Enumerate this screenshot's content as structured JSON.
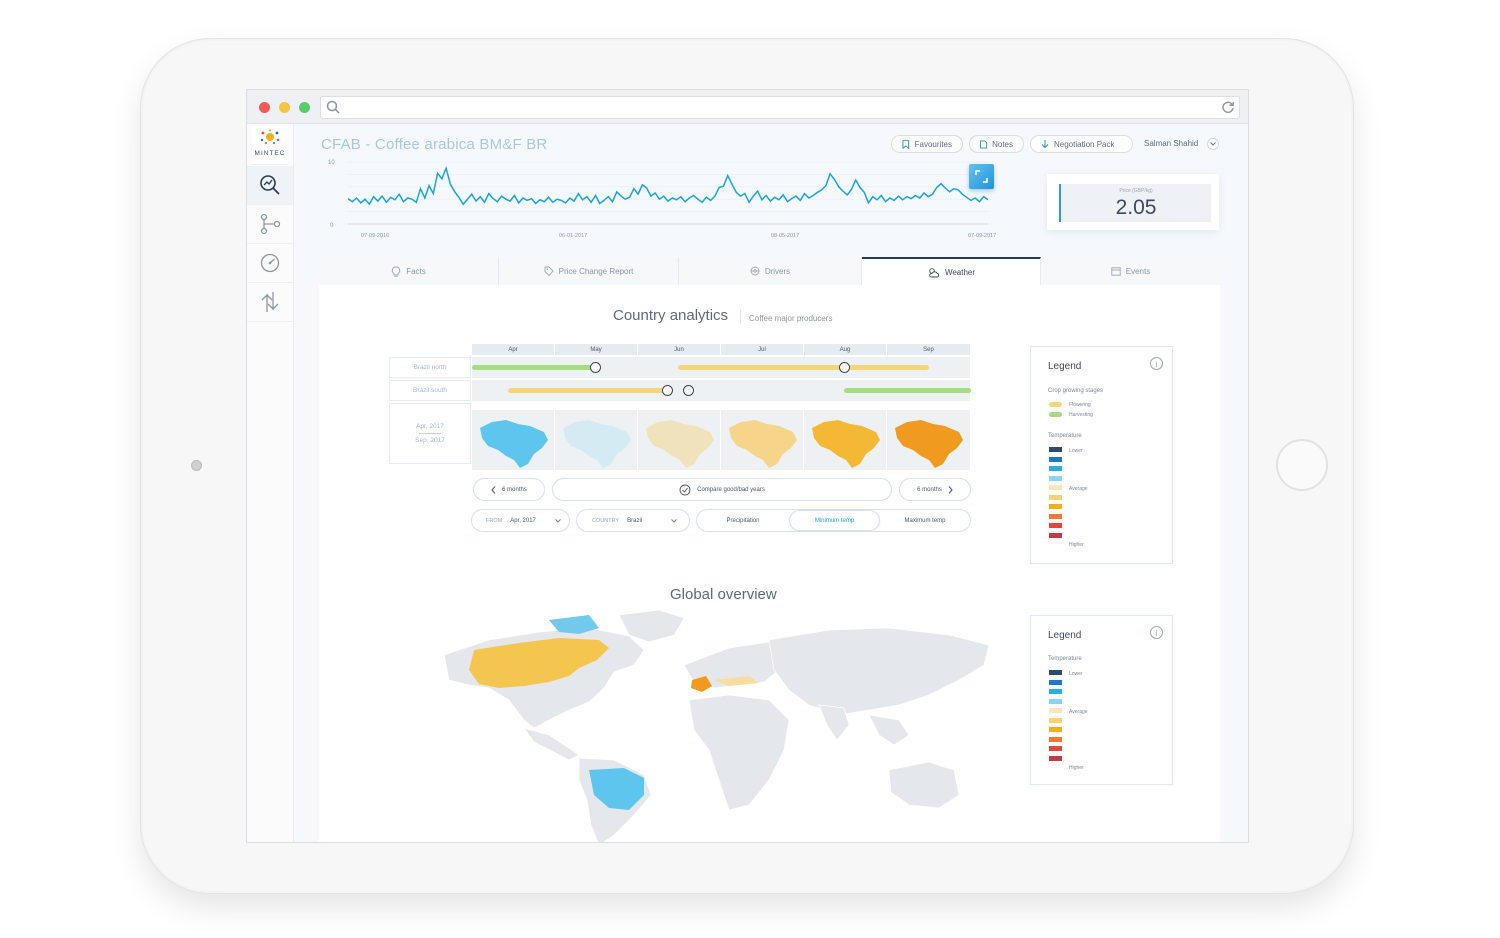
{
  "app": {
    "logo_text": "MINTEC",
    "title": "CFAB - Coffee arabica BM&F BR",
    "user_name": "Salman Shahid"
  },
  "header": {
    "favourites_label": "Favourites",
    "notes_label": "Notes",
    "negotiation_label": "Negotiation Pack"
  },
  "price": {
    "label": "Price (GBP/kg)",
    "value": "2.05"
  },
  "chart_data": {
    "type": "line",
    "ylim": [
      0,
      10
    ],
    "ytick_labels": [
      "10",
      "0"
    ],
    "x_tick_labels": [
      "07-09-2016",
      "06-01-2017",
      "08-05-2017",
      "07-09-2017"
    ],
    "color": "#1aa3dc",
    "values": [
      4.1,
      3.6,
      4.2,
      3.4,
      4.0,
      3.2,
      4.4,
      3.7,
      4.5,
      3.5,
      4.3,
      3.9,
      4.8,
      3.6,
      4.2,
      4.0,
      3.5,
      5.7,
      4.2,
      6.2,
      4.9,
      8.2,
      7.3,
      9.0,
      6.4,
      5.2,
      4.3,
      3.2,
      4.0,
      4.8,
      3.7,
      4.4,
      3.5,
      4.9,
      4.1,
      3.6,
      4.5,
      4.0,
      3.7,
      4.6,
      3.4,
      4.2,
      3.8,
      4.1,
      3.3,
      3.9,
      3.6,
      4.3,
      3.5,
      4.0,
      3.8,
      3.4,
      4.2,
      3.7,
      4.9,
      3.9,
      4.4,
      3.5,
      4.6,
      3.3,
      3.8,
      4.4,
      3.6,
      5.2,
      4.5,
      4.0,
      4.3,
      5.7,
      4.8,
      6.3,
      5.8,
      4.5,
      5.0,
      4.0,
      4.5,
      3.7,
      4.2,
      3.9,
      4.4,
      3.6,
      4.2,
      4.6,
      4.0,
      3.5,
      4.3,
      3.8,
      4.5,
      5.9,
      6.1,
      7.8,
      6.4,
      5.1,
      4.5,
      4.9,
      3.5,
      4.5,
      5.3,
      3.9,
      4.6,
      3.7,
      4.3,
      3.9,
      4.7,
      3.6,
      4.1,
      4.5,
      3.8,
      4.9,
      4.2,
      4.6,
      5.1,
      5.5,
      6.2,
      8.1,
      7.2,
      6.0,
      5.3,
      4.7,
      5.6,
      7.1,
      5.9,
      5.1,
      3.4,
      4.4,
      3.9,
      4.6,
      3.6,
      4.2,
      3.8,
      4.5,
      3.9,
      4.4,
      4.1,
      4.6,
      4.2,
      5.0,
      4.4,
      4.8,
      5.9,
      6.5,
      5.8,
      5.2,
      5.7,
      5.5,
      4.8,
      4.3,
      3.8,
      4.2,
      3.6,
      4.4,
      3.9
    ],
    "axis_color": "#aebdcc"
  },
  "tabs": [
    {
      "label": "Facts"
    },
    {
      "label": "Price Change Report"
    },
    {
      "label": "Drivers"
    },
    {
      "label": "Weather"
    },
    {
      "label": "Events"
    }
  ],
  "country": {
    "title": "Country analytics",
    "subtitle": "Coffee major producers",
    "months": [
      "Apr",
      "May",
      "Jun",
      "Jul",
      "Aug",
      "Sep"
    ],
    "rows": [
      "Brazil north",
      "Brazil south"
    ],
    "date_from": "Apr, 2017",
    "date_to": "Sep, 2017",
    "prev_label": "6 months",
    "compare_label": "Compare good/bad years",
    "next_label": "6 months",
    "from_label": "FROM",
    "from_value": "Apr, 2017",
    "country_label": "COUNTRY",
    "country_value": "Brazil",
    "seg": [
      "Precipitation",
      "Minimum temp",
      "Maximum temp"
    ],
    "map_colors": [
      "#5ec6ee",
      "#d5ebf3",
      "#f0e3bc",
      "#f4d58a",
      "#f3b935",
      "#f09a1f"
    ]
  },
  "legend1": {
    "title": "Legend",
    "info": "i",
    "stages_title": "Crop growing stages",
    "flowering": "Flowering",
    "harvesting": "Harvesting",
    "temp_title": "Temperature",
    "lower": "Lower",
    "average": "Average",
    "higher": "Higher"
  },
  "global": {
    "title": "Global overview"
  },
  "legend2": {
    "title": "Legend",
    "info": "i",
    "temp_title": "Temperature",
    "lower": "Lower",
    "average": "Average",
    "higher": "Higher"
  },
  "colors": {
    "accent": "#1aa3dc",
    "flowering": "#f6d57a",
    "harvesting": "#a6dc82",
    "scale": [
      "#2c4a6a",
      "#1f78c8",
      "#27b0e8",
      "#8cd5f2",
      "#f8e8c2",
      "#f6d476",
      "#f2b020",
      "#ef7a36",
      "#e0483e",
      "#c13b45"
    ]
  }
}
